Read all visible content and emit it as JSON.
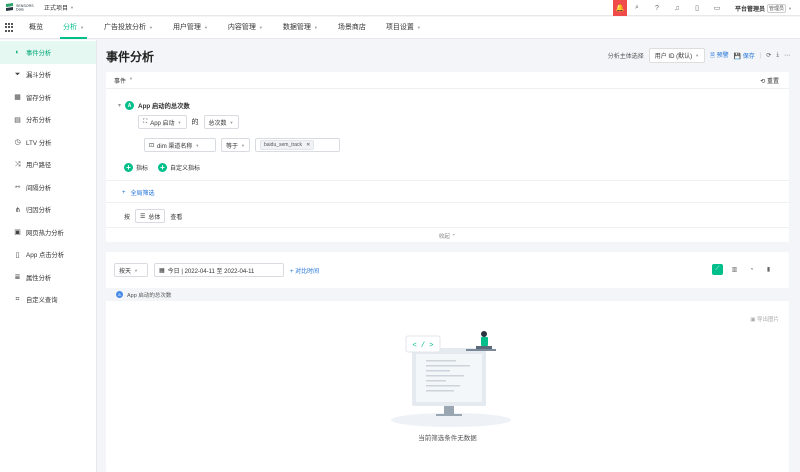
{
  "topbar": {
    "logo_line1": "SENSORS",
    "logo_line2": "Data",
    "project": "正式项目",
    "user_name": "平台管理员",
    "user_role": "管理员"
  },
  "nav": {
    "items": [
      {
        "label": "概览",
        "dropdown": false
      },
      {
        "label": "分析",
        "dropdown": true,
        "active": true
      },
      {
        "label": "广告投放分析",
        "dropdown": true
      },
      {
        "label": "用户管理",
        "dropdown": true
      },
      {
        "label": "内容管理",
        "dropdown": true
      },
      {
        "label": "数据管理",
        "dropdown": true
      },
      {
        "label": "场景商店",
        "dropdown": false
      },
      {
        "label": "项目设置",
        "dropdown": true
      }
    ]
  },
  "sidebar": {
    "items": [
      {
        "label": "事件分析",
        "icon": "event-analysis-icon",
        "glyph": "◐",
        "active": true
      },
      {
        "label": "漏斗分析",
        "icon": "funnel-icon",
        "glyph": "⏷"
      },
      {
        "label": "留存分析",
        "icon": "retention-icon",
        "glyph": "▦"
      },
      {
        "label": "分布分析",
        "icon": "distribution-icon",
        "glyph": "▤"
      },
      {
        "label": "LTV 分析",
        "icon": "ltv-icon",
        "glyph": "◷"
      },
      {
        "label": "用户路径",
        "icon": "user-path-icon",
        "glyph": "⤨"
      },
      {
        "label": "间隔分析",
        "icon": "interval-icon",
        "glyph": "⇿"
      },
      {
        "label": "归因分析",
        "icon": "attribution-icon",
        "glyph": "⋔"
      },
      {
        "label": "网页热力分析",
        "icon": "web-heatmap-icon",
        "glyph": "▣"
      },
      {
        "label": "App 点击分析",
        "icon": "app-click-icon",
        "glyph": "▯"
      },
      {
        "label": "属性分析",
        "icon": "property-icon",
        "glyph": "≣"
      },
      {
        "label": "自定义查询",
        "icon": "custom-query-icon",
        "glyph": "⌗"
      }
    ]
  },
  "header": {
    "title": "事件分析",
    "subject_label": "分析主体选择",
    "subject_value": "用户 ID (默认)",
    "alert_label": "预警",
    "save_label": "保存"
  },
  "query": {
    "event_label": "事件",
    "reset_label": "重置",
    "metric_badge": "A",
    "metric_name": "App 启动的总次数",
    "event_select": "App 启动",
    "of_label": "的",
    "measure_select": "总次数",
    "filter_property": "dim 渠道名称",
    "filter_operator": "等于",
    "filter_value": "baidu_sem_track",
    "add_metric": "指标",
    "add_custom_metric": "自定义指标",
    "global_filter": "全局筛选",
    "group_by_label": "按",
    "group_by_value": "总体",
    "group_by_suffix": "查看",
    "collapse_label": "收起"
  },
  "results": {
    "granularity": "按天",
    "date_range": "今日 | 2022-04-11 至 2022-04-11",
    "compare_label": "+ 对比时间",
    "series_badge": "A",
    "series_label": "App 启动的总次数",
    "export_label": "导出图片",
    "empty_text": "当前筛选条件无数据",
    "illus_code": "< / >"
  },
  "colors": {
    "accent": "#00bf8a",
    "link": "#1b6fd8",
    "alert": "#f04b4b"
  }
}
